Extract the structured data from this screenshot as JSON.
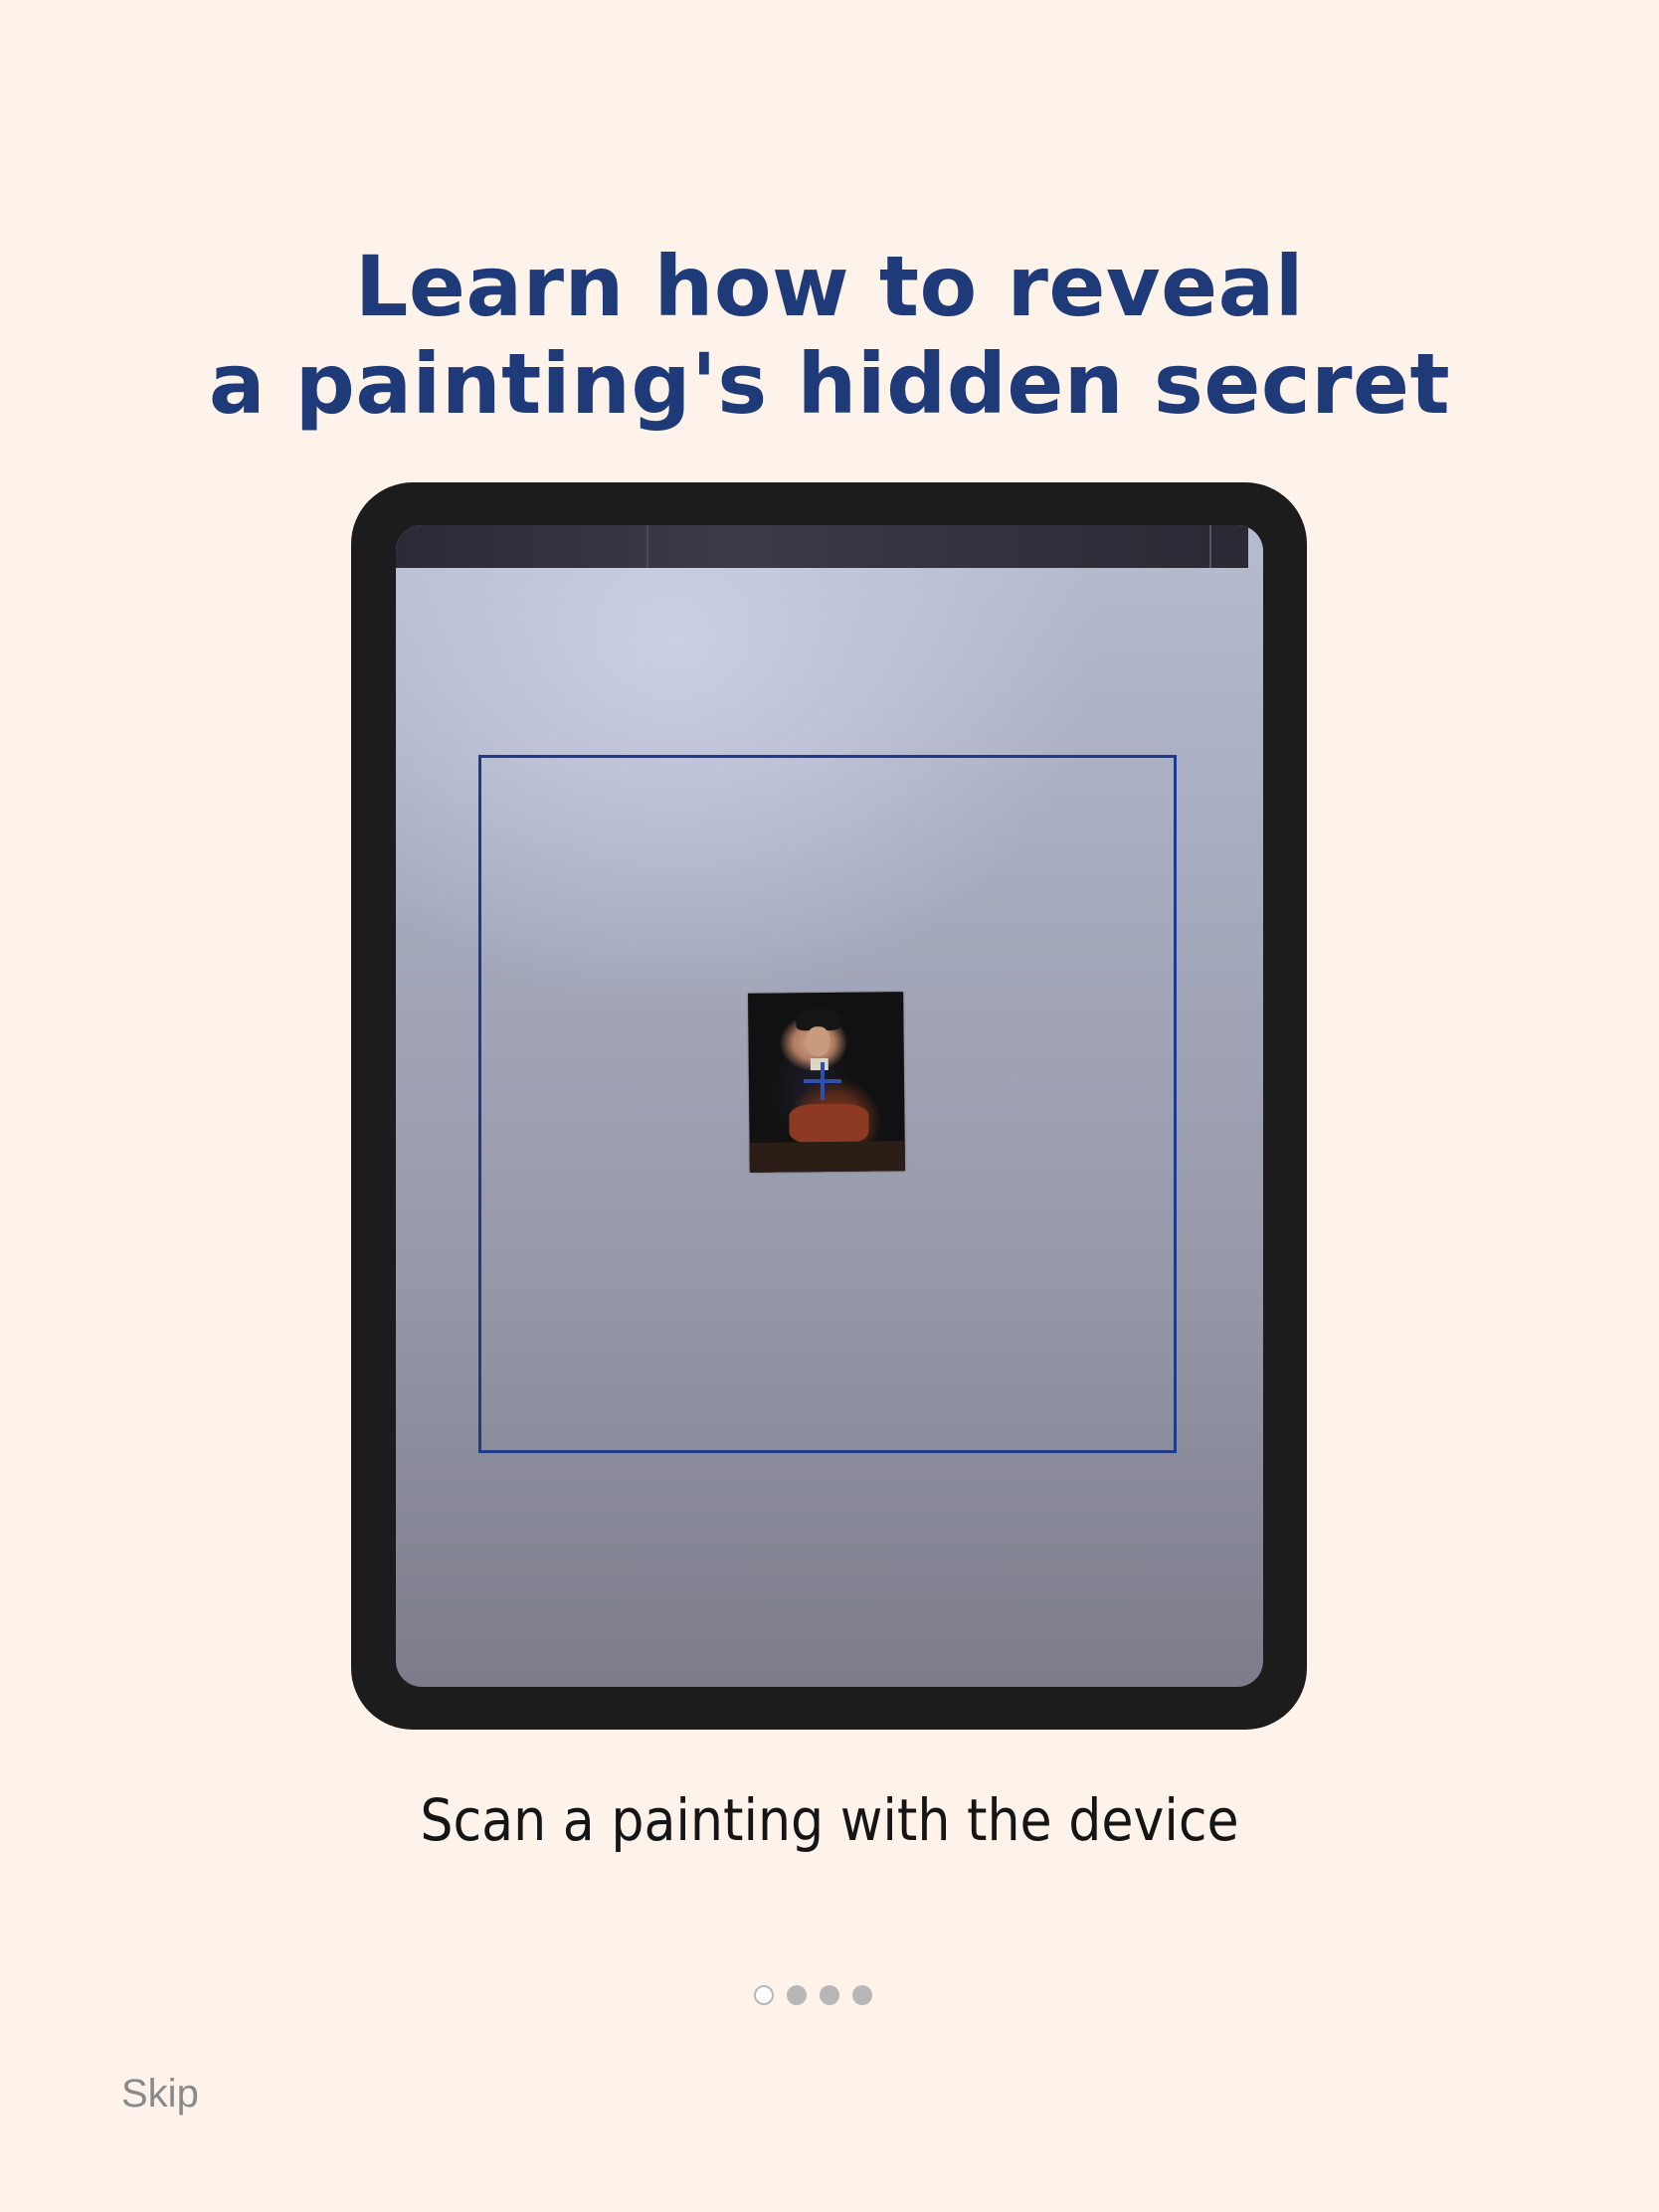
{
  "onboarding": {
    "title_line1": "Learn how to reveal",
    "title_line2": "a painting's hidden secret",
    "caption": "Scan a painting with the device",
    "skip_label": "Skip",
    "page_indicator": {
      "total": 4,
      "current": 1
    }
  },
  "colors": {
    "background": "#fdf3ea",
    "title": "#1f3a78",
    "scan_frame": "#1f3a8a",
    "device_bezel": "#1c1c1c",
    "skip_text": "#8a8a8a"
  },
  "icons": {
    "crosshair": "crosshair-icon"
  }
}
